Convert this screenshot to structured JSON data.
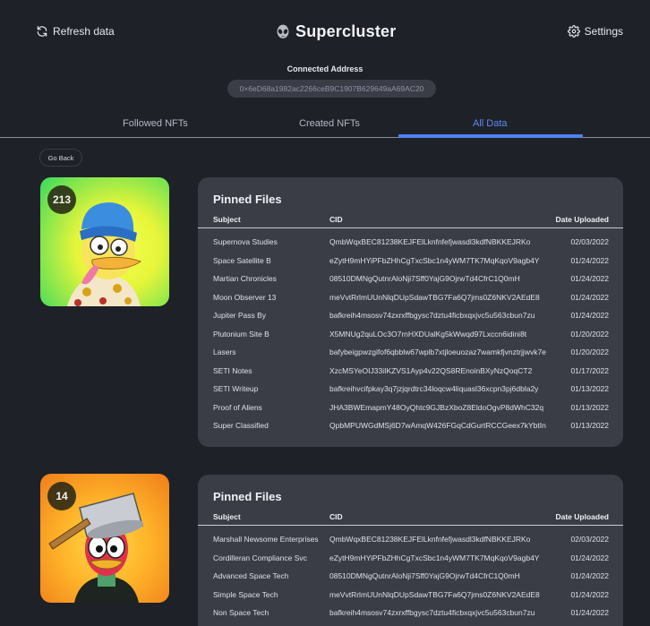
{
  "header": {
    "refresh_label": "Refresh data",
    "app_title": "Supercluster",
    "settings_label": "Settings"
  },
  "address": {
    "label": "Connected Address",
    "value": "0×6eD68a1982ac2266ceB9C1907B629649aA69AC20"
  },
  "tabs": [
    {
      "label": "Followed NFTs",
      "active": false
    },
    {
      "label": "Created NFTs",
      "active": false
    },
    {
      "label": "All Data",
      "active": true
    }
  ],
  "go_back_label": "Go Back",
  "colors": {
    "background": "#1f2129",
    "card": "#3a3c46",
    "accent": "#4f82f0"
  },
  "columns": {
    "subject": "Subject",
    "cid": "CID",
    "date": "Date Uploaded"
  },
  "cards": [
    {
      "badge": "213",
      "title": "Pinned Files",
      "rows": [
        {
          "subject": "Supernova Studies",
          "cid": "QmbWqxBEC81238KEJFElLknfnfefjwasdl3kdfNBKKEJRKo",
          "date": "02/03/2022"
        },
        {
          "subject": "Space Satellite B",
          "cid": "eZytH9mHYiPFbZHhCgTxcSbc1n4yWM7TK7MqKqoV9agb4Y",
          "date": "01/24/2022"
        },
        {
          "subject": "Martian Chronicles",
          "cid": "08510DMNgQutnrAloNji7Sff0YajG9OjrwTd4CfrC1Q0mH",
          "date": "01/24/2022"
        },
        {
          "subject": "Moon Observer 13",
          "cid": "meVvtRrlmUUnNlqDUpSdawTBG7Fa6Q7jms0Z6NKV2AEdE8",
          "date": "01/24/2022"
        },
        {
          "subject": "Jupiter Pass By",
          "cid": "bafkreih4msosv74zxrxffbgysc7dztu4ficbxqxjvc5u563cbun7zu",
          "date": "01/24/2022"
        },
        {
          "subject": "Plutonium Site B",
          "cid": "X5MNUg2quLOc3O7rnHXDUalKg5kWwqd97Lxccn6idini8t",
          "date": "01/20/2022"
        },
        {
          "subject": "Lasers",
          "cid": "bafybeigpwzgifof6qbblw67wplb7xtjloeuozaz7wamkfjvnztrjjwvk7e",
          "date": "01/20/2022"
        },
        {
          "subject": "SETI Notes",
          "cid": "XzcMSYeOIJ33iIKZVS1Ayp4v22QS8REnoinBXyNzQoqCT2",
          "date": "01/17/2022"
        },
        {
          "subject": "SETI Writeup",
          "cid": "bafkreihvcifpkay3q7jzjqrdtrc34loqcw4liquasl36xcpn3pj6dbla2y",
          "date": "01/13/2022"
        },
        {
          "subject": "Proof of Aliens",
          "cid": "JHA3BWEmapmY48OyQhtc9GJBzXboZ8EldoOgvP8dWhC32q",
          "date": "01/13/2022"
        },
        {
          "subject": "Super Classified",
          "cid": "QpbMPUWGdMSj6D7wAmqW426FGqCdGurtRCCGeex7kYbtIn",
          "date": "01/13/2022"
        }
      ]
    },
    {
      "badge": "14",
      "title": "Pinned Files",
      "rows": [
        {
          "subject": "Marshall Newsome Enterprises",
          "cid": "QmbWqxBEC81238KEJFElLknfnfefjwasdl3kdfNBKKEJRKo",
          "date": "02/03/2022"
        },
        {
          "subject": "Cordilleran Compliance Svc",
          "cid": "eZytH9mHYiPFbZHhCgTxcSbc1n4yWM7TK7MqKqoV9agb4Y",
          "date": "01/24/2022"
        },
        {
          "subject": "Advanced Space Tech",
          "cid": "08510DMNgQutnrAloNji7Sff0YajG9OjrwTd4CfrC1Q0mH",
          "date": "01/24/2022"
        },
        {
          "subject": "Simple Space Tech",
          "cid": "meVvtRrlmUUnNlqDUpSdawTBG7Fa6Q7jms0Z6NKV2AEdE8",
          "date": "01/24/2022"
        },
        {
          "subject": "Non Space Tech",
          "cid": "bafkreih4msosv74zxrxffbgysc7dztu4ficbxqxjvc5u563cbun7zu",
          "date": "01/24/2022"
        }
      ]
    }
  ]
}
